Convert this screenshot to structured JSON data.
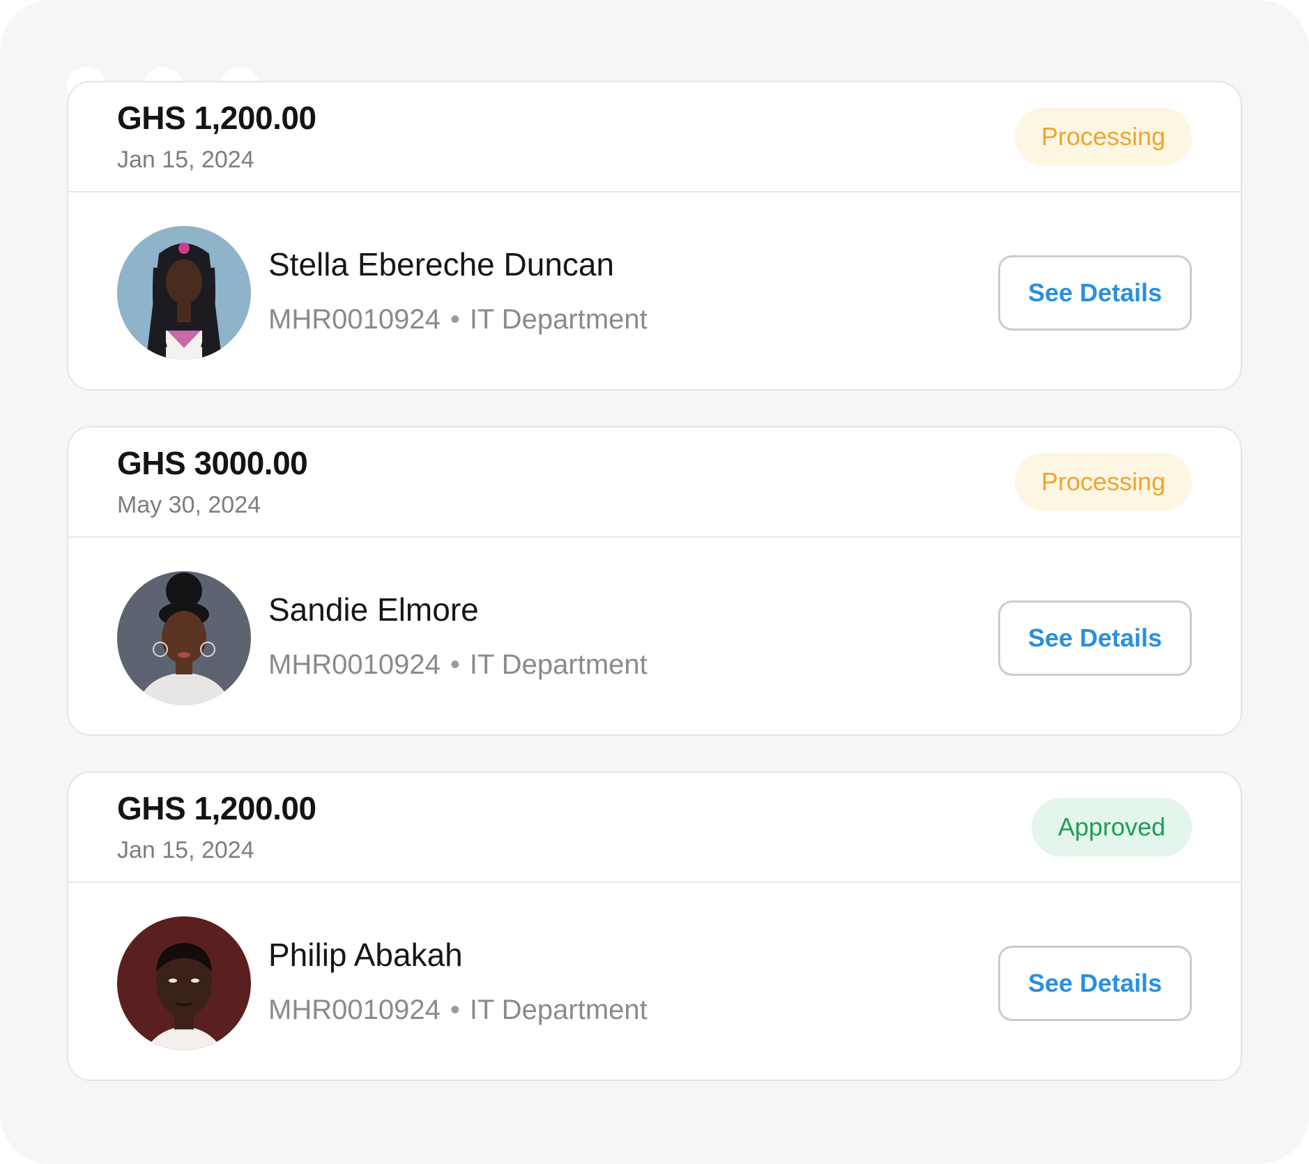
{
  "requests": [
    {
      "amount": "GHS 1,200.00",
      "date": "Jan 15, 2024",
      "status": "Processing",
      "status_type": "processing",
      "name": "Stella Ebereche Duncan",
      "employee_id": "MHR0010924",
      "separator": "•",
      "department": "IT Department",
      "action_label": "See Details",
      "avatar_colors": {
        "bg": "#8fb3c9",
        "skin": "#4a2c1e",
        "hair": "#1c1b22",
        "shirt": "#f4f1ee"
      }
    },
    {
      "amount": "GHS 3000.00",
      "date": "May 30, 2024",
      "status": "Processing",
      "status_type": "processing",
      "name": "Sandie Elmore",
      "employee_id": "MHR0010924",
      "separator": "•",
      "department": "IT Department",
      "action_label": "See Details",
      "avatar_colors": {
        "bg": "#5d6370",
        "skin": "#5a3323",
        "hair": "#141316",
        "shirt": "#e8e6e4"
      }
    },
    {
      "amount": "GHS 1,200.00",
      "date": "Jan 15, 2024",
      "status": "Approved",
      "status_type": "approved",
      "name": "Philip Abakah",
      "employee_id": "MHR0010924",
      "separator": "•",
      "department": "IT Department",
      "action_label": "See Details",
      "avatar_colors": {
        "bg": "#5a1f1f",
        "skin": "#3b2218",
        "hair": "#120d0b",
        "shirt": "#f2efec"
      }
    }
  ],
  "colors": {
    "processing_text": "#f0a42e",
    "processing_bg": "#fdf6e3",
    "approved_text": "#1e9e56",
    "approved_bg": "#e4f5ec",
    "link_blue": "#2a8fdf"
  }
}
